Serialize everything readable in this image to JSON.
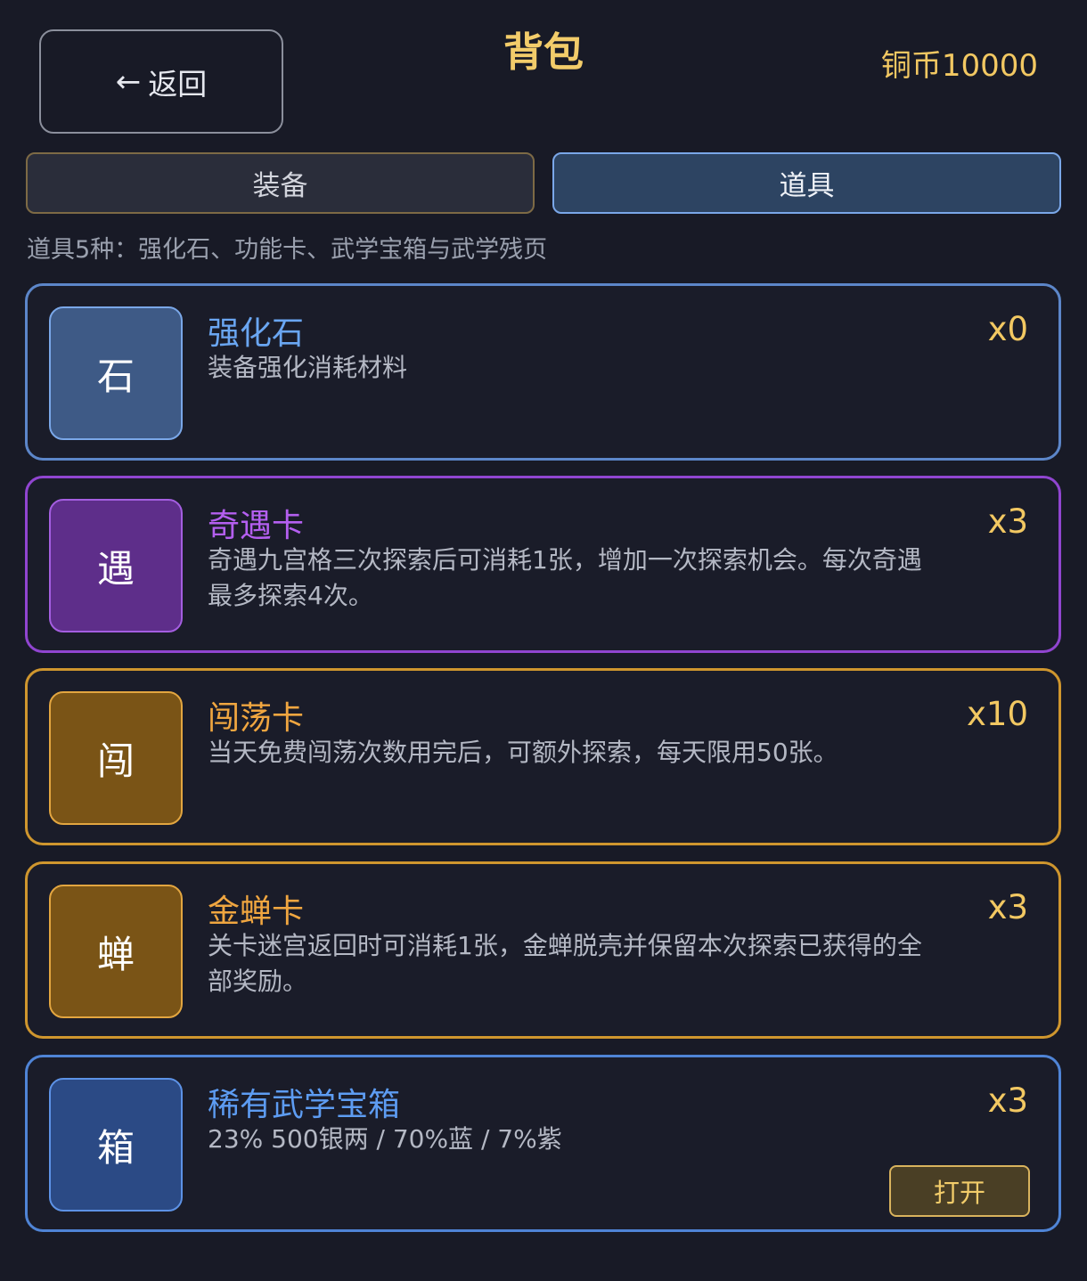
{
  "header": {
    "back_arrow": "←",
    "back_label": "返回",
    "title": "背包",
    "coins": "铜币10000"
  },
  "tabs": [
    {
      "label": "装备",
      "active": false
    },
    {
      "label": "道具",
      "active": true
    }
  ],
  "summary": "道具5种：强化石、功能卡、武学宝箱与武学残页",
  "items": [
    {
      "icon": "石",
      "name": "强化石",
      "desc": "装备强化消耗材料",
      "count": "x0",
      "theme": "blue",
      "color": "#6aa6f2"
    },
    {
      "icon": "遇",
      "name": "奇遇卡",
      "desc": "奇遇九宫格三次探索后可消耗1张，增加一次探索机会。每次奇遇最多探索4次。",
      "count": "x3",
      "theme": "purple",
      "color": "#b45ff0"
    },
    {
      "icon": "闯",
      "name": "闯荡卡",
      "desc": "当天免费闯荡次数用完后，可额外探索，每天限用50张。",
      "count": "x10",
      "theme": "gold",
      "color": "#f0a640"
    },
    {
      "icon": "蝉",
      "name": "金蝉卡",
      "desc": "关卡迷宫返回时可消耗1张，金蝉脱壳并保留本次探索已获得的全部奖励。",
      "count": "x3",
      "theme": "gold",
      "color": "#f0a640"
    },
    {
      "icon": "箱",
      "name": "稀有武学宝箱",
      "desc": "23% 500银两 / 70%蓝 / 7%紫",
      "count": "x3",
      "theme": "navy",
      "color": "#5d9cf2",
      "action_label": "打开"
    }
  ]
}
